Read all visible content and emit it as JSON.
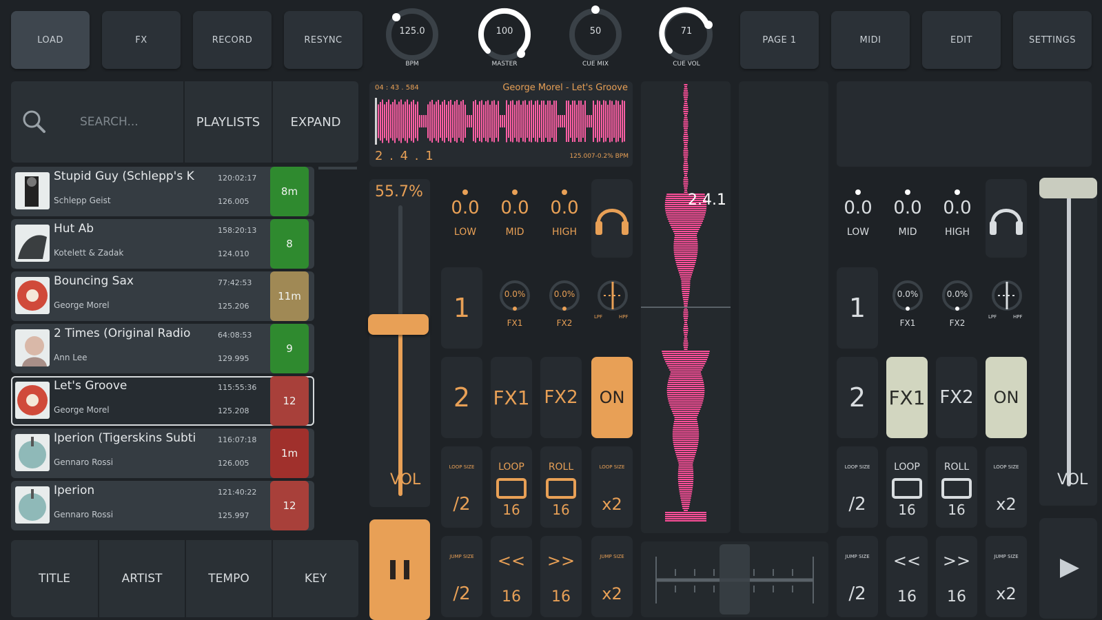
{
  "toolbar": {
    "load": "LOAD",
    "fx": "FX",
    "record": "RECORD",
    "resync": "RESYNC",
    "page": "PAGE 1",
    "midi": "MIDI",
    "edit": "EDIT",
    "settings": "SETTINGS"
  },
  "knobs": [
    {
      "value": "125.0",
      "label": "BPM",
      "level": 0.05
    },
    {
      "value": "100",
      "label": "MASTER",
      "level": 0.8
    },
    {
      "value": "50",
      "label": "CUE MIX",
      "level": 0.5
    },
    {
      "value": "71",
      "label": "CUE VOL",
      "level": 0.62
    }
  ],
  "browser": {
    "search_placeholder": "SEARCH...",
    "playlists": "PLAYLISTS",
    "expand": "EXPAND",
    "tracks": [
      {
        "title": "Stupid Guy (Schlepp's K",
        "artist": "Schlepp Geist",
        "time": "120:02:17",
        "bpm": "126.005",
        "key": "8m",
        "key_color": "#2f8a2f",
        "art": "person"
      },
      {
        "title": "Hut Ab",
        "artist": "Kotelett & Zadak",
        "time": "158:20:13",
        "bpm": "124.010",
        "key": "8",
        "key_color": "#2f8a2f",
        "art": "bird"
      },
      {
        "title": "Bouncing Sax",
        "artist": "George Morel",
        "time": "77:42:53",
        "bpm": "125.206",
        "key": "11m",
        "key_color": "#a08955",
        "art": "record"
      },
      {
        "title": "2 Times (Original Radio",
        "artist": "Ann Lee",
        "time": "64:08:53",
        "bpm": "129.995",
        "key": "9",
        "key_color": "#2f8a2f",
        "art": "face"
      },
      {
        "title": "Let's Groove",
        "artist": "George Morel",
        "time": "115:55:36",
        "bpm": "125.208",
        "key": "12",
        "key_color": "#a8403a",
        "art": "record",
        "selected": true
      },
      {
        "title": "Iperion (Tigerskins Subti",
        "artist": "Gennaro Rossi",
        "time": "116:07:18",
        "bpm": "126.005",
        "key": "1m",
        "key_color": "#a0302c",
        "art": "teal"
      },
      {
        "title": "Iperion",
        "artist": "Gennaro Rossi",
        "time": "121:40:22",
        "bpm": "125.997",
        "key": "12",
        "key_color": "#a8403a",
        "art": "teal"
      }
    ],
    "sort": [
      "TITLE",
      "ARTIST",
      "TEMPO",
      "KEY"
    ]
  },
  "deckA": {
    "header_left": "04 : 43 . 584",
    "track": "George Morel - Let's Groove",
    "position": "2 . 4 . 1",
    "tempo": "125.007-0.2% BPM",
    "pitch": "55.7%",
    "vol_label": "VOL",
    "eq": [
      {
        "value": "0.0",
        "label": "LOW"
      },
      {
        "value": "0.0",
        "label": "MID"
      },
      {
        "value": "0.0",
        "label": "HIGH"
      }
    ],
    "fx_knobs": [
      {
        "value": "0.0%",
        "label": "FX1"
      },
      {
        "value": "0.0%",
        "label": "FX2"
      }
    ],
    "filter_labels": [
      "LPF",
      "HPF"
    ],
    "num1": "1",
    "num2": "2",
    "fx1": "FX1",
    "fx2": "FX2",
    "on": "ON",
    "loop_size": "LOOP SIZE",
    "loop": "LOOP",
    "roll": "ROLL",
    "jump_size": "JUMP SIZE",
    "half": "/2",
    "sixteen": "16",
    "double": "x2",
    "rew": "<<",
    "fwd": ">>"
  },
  "center": {
    "beat_position": "2.4.1"
  },
  "deckB": {
    "vol_label": "VOL",
    "eq": [
      {
        "value": "0.0",
        "label": "LOW"
      },
      {
        "value": "0.0",
        "label": "MID"
      },
      {
        "value": "0.0",
        "label": "HIGH"
      }
    ],
    "fx_knobs": [
      {
        "value": "0.0%",
        "label": "FX1"
      },
      {
        "value": "0.0%",
        "label": "FX2"
      }
    ],
    "filter_labels": [
      "LPF",
      "HPF"
    ],
    "num1": "1",
    "num2": "2",
    "fx1": "FX1",
    "fx2": "FX2",
    "on": "ON",
    "loop_size": "LOOP SIZE",
    "loop": "LOOP",
    "roll": "ROLL",
    "jump_size": "JUMP SIZE",
    "half": "/2",
    "sixteen": "16",
    "double": "x2",
    "rew": "<<",
    "fwd": ">>"
  },
  "colors": {
    "accent": "#e8a056",
    "wave": "#ff4f9a",
    "bg": "#1e2226",
    "panel": "#2a3035"
  }
}
